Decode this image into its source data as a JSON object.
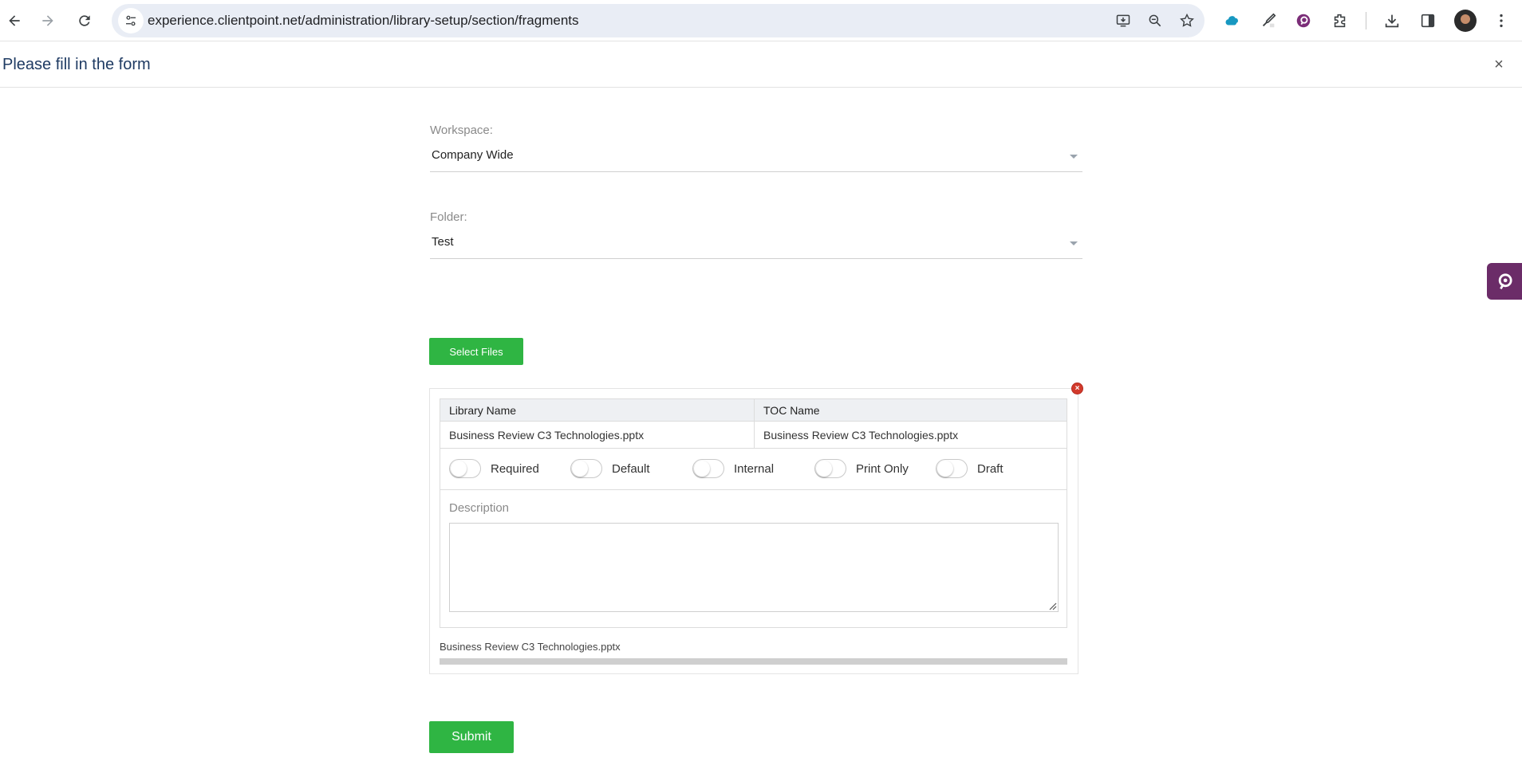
{
  "browser": {
    "url": "experience.clientpoint.net/administration/library-setup/section/fragments"
  },
  "page": {
    "title": "Please fill in the form",
    "close_glyph": "×"
  },
  "form": {
    "workspace": {
      "label": "Workspace:",
      "value": "Company Wide"
    },
    "folder": {
      "label": "Folder:",
      "value": "Test"
    },
    "select_files_label": "Select Files",
    "submit_label": "Submit"
  },
  "upload": {
    "remove_glyph": "×",
    "table": {
      "headers": [
        "Library Name",
        "TOC Name"
      ],
      "row": [
        "Business Review C3 Technologies.pptx",
        "Business Review C3 Technologies.pptx"
      ]
    },
    "toggles": [
      {
        "label": "Required",
        "on": false
      },
      {
        "label": "Default",
        "on": false
      },
      {
        "label": "Internal",
        "on": false
      },
      {
        "label": "Print Only",
        "on": false
      },
      {
        "label": "Draft",
        "on": false
      }
    ],
    "description_label": "Description",
    "description_value": "",
    "file_name": "Business Review C3 Technologies.pptx",
    "progress_fraction": 1.0
  },
  "colors": {
    "accent_green": "#2fb543",
    "title_blue": "#1f3b63",
    "widget_purple": "#6b2c68"
  }
}
